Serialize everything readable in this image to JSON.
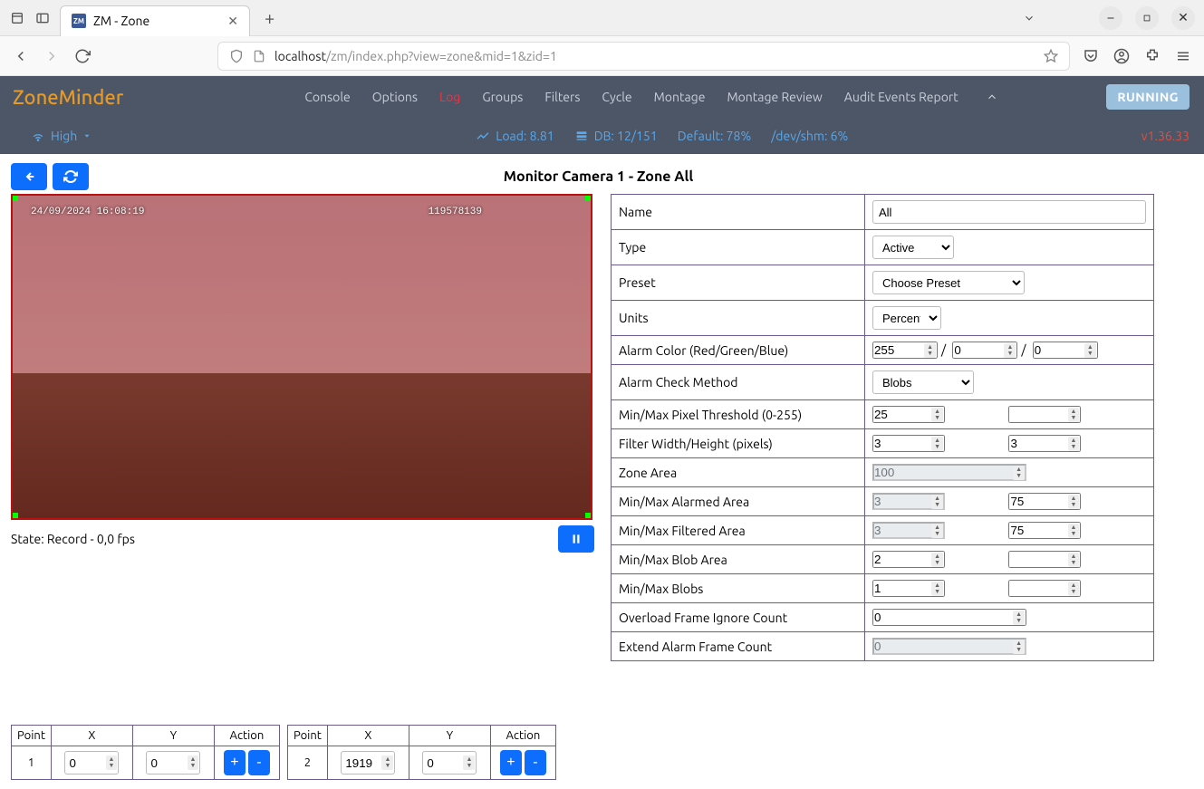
{
  "browser": {
    "tab_title": "ZM - Zone",
    "favicon_text": "ZM",
    "url_prefix": "localhost",
    "url_path": "/zm/index.php?view=zone&mid=1&zid=1"
  },
  "header": {
    "brand": "ZoneMinder",
    "nav": [
      "Console",
      "Options",
      "Log",
      "Groups",
      "Filters",
      "Cycle",
      "Montage",
      "Montage Review",
      "Audit Events Report"
    ],
    "run_state": "RUNNING",
    "bandwidth": "High",
    "load": "Load: 8.81",
    "db": "DB: 12/151",
    "storage": "Default: 78%",
    "shm": "/dev/shm: 6%",
    "version": "v1.36.33"
  },
  "page": {
    "title": "Monitor Camera 1 - Zone All",
    "state": "State: Record - 0,0 fps",
    "timestamp": "24/09/2024 16:08:19",
    "frame_id": "119578139"
  },
  "form": {
    "name_label": "Name",
    "name": "All",
    "type_label": "Type",
    "type": "Active",
    "preset_label": "Preset",
    "preset": "Choose Preset",
    "units_label": "Units",
    "units": "Percent",
    "alarm_color_label": "Alarm Color (Red/Green/Blue)",
    "alarm_r": "255",
    "alarm_g": "0",
    "alarm_b": "0",
    "check_method_label": "Alarm Check Method",
    "check_method": "Blobs",
    "pixel_thresh_label": "Min/Max Pixel Threshold (0-255)",
    "pixel_min": "25",
    "pixel_max": "",
    "filter_wh_label": "Filter Width/Height (pixels)",
    "filter_w": "3",
    "filter_h": "3",
    "zone_area_label": "Zone Area",
    "zone_area": "100",
    "alarmed_area_label": "Min/Max Alarmed Area",
    "alarmed_min": "3",
    "alarmed_max": "75",
    "filtered_area_label": "Min/Max Filtered Area",
    "filtered_min": "3",
    "filtered_max": "75",
    "blob_area_label": "Min/Max Blob Area",
    "blob_min": "2",
    "blob_max": "",
    "blobs_label": "Min/Max Blobs",
    "blobs_min": "1",
    "blobs_max": "",
    "overload_label": "Overload Frame Ignore Count",
    "overload": "0",
    "extend_label": "Extend Alarm Frame Count",
    "extend": "0"
  },
  "points_headers": {
    "point": "Point",
    "x": "X",
    "y": "Y",
    "action": "Action"
  },
  "points": [
    {
      "n": "1",
      "x": "0",
      "y": "0"
    },
    {
      "n": "2",
      "x": "1919",
      "y": "0"
    }
  ]
}
